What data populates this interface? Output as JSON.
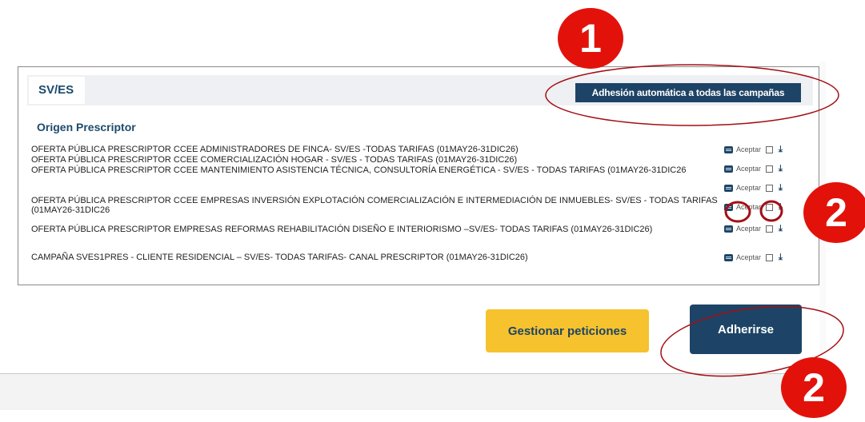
{
  "panel": {
    "tag": "SV/ES",
    "adhesion_button": "Adhesión automática a todas las campañas",
    "section_title": "Origen Prescriptor"
  },
  "offers": [
    {
      "text": "OFERTA PÚBLICA PRESCRIPTOR CCEE ADMINISTRADORES DE FINCA- SV/ES -TODAS TARIFAS (01MAY26-31DIC26)",
      "accept_label": "Aceptar"
    },
    {
      "text": "OFERTA PÚBLICA PRESCRIPTOR CCEE COMERCIALIZACIÓN HOGAR - SV/ES - TODAS TARIFAS (01MAY26-31DIC26)",
      "accept_label": "Aceptar"
    },
    {
      "text": "OFERTA PÚBLICA PRESCRIPTOR CCEE MANTENIMIENTO ASISTENCIA TÉCNICA, CONSULTORÍA ENERGÉTICA - SV/ES - TODAS TARIFAS (01MAY26-31DIC26",
      "accept_label": "Aceptar"
    },
    {
      "text": "OFERTA PÚBLICA PRESCRIPTOR CCEE EMPRESAS INVERSIÓN EXPLOTACIÓN COMERCIALIZACIÓN E INTERMEDIACIÓN DE INMUEBLES- SV/ES - TODAS TARIFAS (01MAY26-31DIC26",
      "accept_label": "Aceptar"
    },
    {
      "text": "OFERTA PÚBLICA PRESCRIPTOR EMPRESAS REFORMAS REHABILITACIÓN DISEÑO E INTERIORISMO –SV/ES- TODAS TARIFAS (01MAY26-31DIC26)",
      "accept_label": "Aceptar"
    },
    {
      "text": "CAMPAÑA SVES1PRES - CLIENTE RESIDENCIAL – SV/ES- TODAS TARIFAS- CANAL PRESCRIPTOR (01MAY26-31DIC26)",
      "accept_label": "Aceptar"
    }
  ],
  "buttons": {
    "gestionar": "Gestionar peticiones",
    "adherirse": "Adherirse"
  },
  "annotations": {
    "badge_1": "1",
    "badge_2a": "2",
    "badge_2b": "2",
    "color": "#e2120b",
    "ring_color": "#a30f14"
  },
  "colors": {
    "navy": "#1d4466",
    "yellow": "#f6c22d"
  }
}
